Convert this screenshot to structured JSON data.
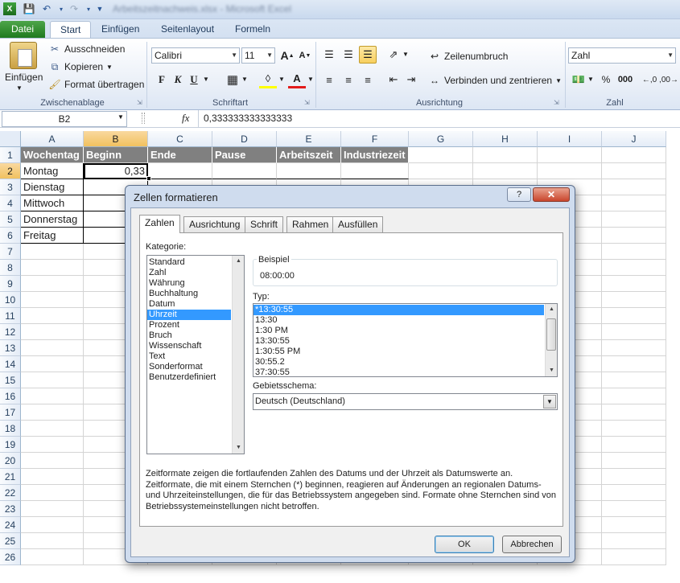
{
  "window": {
    "title": "Arbeitszeitnachweis.xlsx - Microsoft Excel"
  },
  "ribbon": {
    "tabs": [
      "Datei",
      "Start",
      "Einfügen",
      "Seitenlayout",
      "Formeln"
    ],
    "clipboard": {
      "paste": "Einfügen",
      "cut": "Ausschneiden",
      "copy": "Kopieren",
      "format_painter": "Format übertragen",
      "label": "Zwischenablage"
    },
    "font": {
      "name": "Calibri",
      "size": "11",
      "bold": "F",
      "italic": "K",
      "underline": "U",
      "label": "Schriftart",
      "grow": "A",
      "shrink": "A",
      "color": "A"
    },
    "alignment": {
      "wrap": "Zeilenumbruch",
      "merge": "Verbinden und zentrieren",
      "label": "Ausrichtung"
    },
    "number": {
      "format": "Zahl",
      "label": "Zahl",
      "percent": "%",
      "thousands": "000"
    }
  },
  "formula_bar": {
    "name_box": "B2",
    "fx": "fx",
    "value": "0,333333333333333"
  },
  "sheet": {
    "columns": [
      "A",
      "B",
      "C",
      "D",
      "E",
      "F",
      "G",
      "H",
      "I",
      "J"
    ],
    "rows": [
      "1",
      "2",
      "3",
      "4",
      "5",
      "6",
      "7",
      "8",
      "9",
      "10",
      "11",
      "12",
      "13",
      "14",
      "15",
      "16",
      "17",
      "18",
      "19",
      "20",
      "21",
      "22",
      "23",
      "24",
      "25",
      "26"
    ],
    "header_row": [
      "Wochentag",
      "Beginn",
      "Ende",
      "Pause",
      "Arbeitszeit",
      "Industriezeit"
    ],
    "data": [
      [
        "Montag",
        "0,33"
      ],
      [
        "Dienstag"
      ],
      [
        "Mittwoch"
      ],
      [
        "Donnerstag"
      ],
      [
        "Freitag"
      ]
    ]
  },
  "dialog": {
    "title": "Zellen formatieren",
    "help": "?",
    "close": "✕",
    "tabs": [
      "Zahlen",
      "Ausrichtung",
      "Schrift",
      "Rahmen",
      "Ausfüllen"
    ],
    "category_label": "Kategorie:",
    "categories": [
      "Standard",
      "Zahl",
      "Währung",
      "Buchhaltung",
      "Datum",
      "Uhrzeit",
      "Prozent",
      "Bruch",
      "Wissenschaft",
      "Text",
      "Sonderformat",
      "Benutzerdefiniert"
    ],
    "selected_category": "Uhrzeit",
    "sample_label": "Beispiel",
    "sample_value": "08:00:00",
    "type_label": "Typ:",
    "types": [
      "*13:30:55",
      "13:30",
      "1:30 PM",
      "13:30:55",
      "1:30:55 PM",
      "30:55.2",
      "37:30:55"
    ],
    "locale_label": "Gebietsschema:",
    "locale_value": "Deutsch (Deutschland)",
    "description": "Zeitformate zeigen die fortlaufenden Zahlen des Datums und der Uhrzeit als Datumswerte an. Zeitformate, die mit einem Sternchen (*) beginnen, reagieren auf Änderungen an regionalen Datums- und Uhrzeiteinstellungen, die für das Betriebssystem angegeben sind. Formate ohne Sternchen sind von Betriebssystemeinstellungen nicht betroffen.",
    "ok": "OK",
    "cancel": "Abbrechen"
  }
}
